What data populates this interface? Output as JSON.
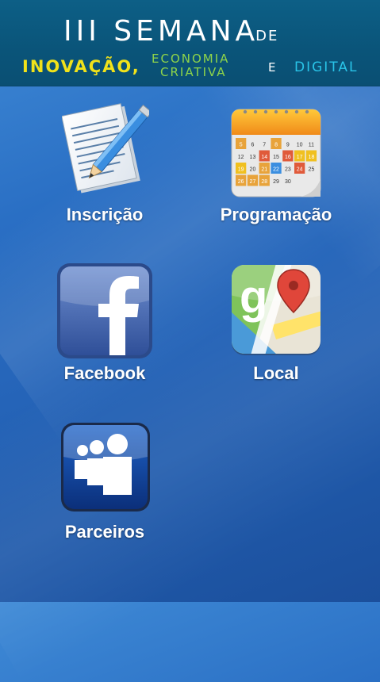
{
  "banner": {
    "line1": "III SEMANA",
    "line1_suffix": "DE",
    "inovacao": "INOVAÇÃO,",
    "economia": "ECONOMIA",
    "criativa": "CRIATIVA",
    "e": "E",
    "digital": "DIGITAL"
  },
  "menu": {
    "inscricao": {
      "label": "Inscrição",
      "icon": "notepad-pencil-icon"
    },
    "programacao": {
      "label": "Programação",
      "icon": "calendar-icon"
    },
    "facebook": {
      "label": "Facebook",
      "icon": "facebook-icon"
    },
    "local": {
      "label": "Local",
      "icon": "google-maps-icon"
    },
    "parceiros": {
      "label": "Parceiros",
      "icon": "myspace-people-icon"
    }
  },
  "calendar": {
    "rows": [
      [
        "5",
        "6",
        "7",
        "8",
        "9",
        "10",
        "11"
      ],
      [
        "12",
        "13",
        "14",
        "15",
        "16",
        "17",
        "18"
      ],
      [
        "19",
        "20",
        "21",
        "22",
        "23",
        "24",
        "25"
      ],
      [
        "26",
        "27",
        "28",
        "29",
        "30",
        "",
        ""
      ]
    ]
  },
  "colors": {
    "background": "#2564b8",
    "banner": "#0a5479",
    "yellow": "#f1e21a",
    "green": "#8ed44a",
    "cyan": "#29c4e8"
  }
}
